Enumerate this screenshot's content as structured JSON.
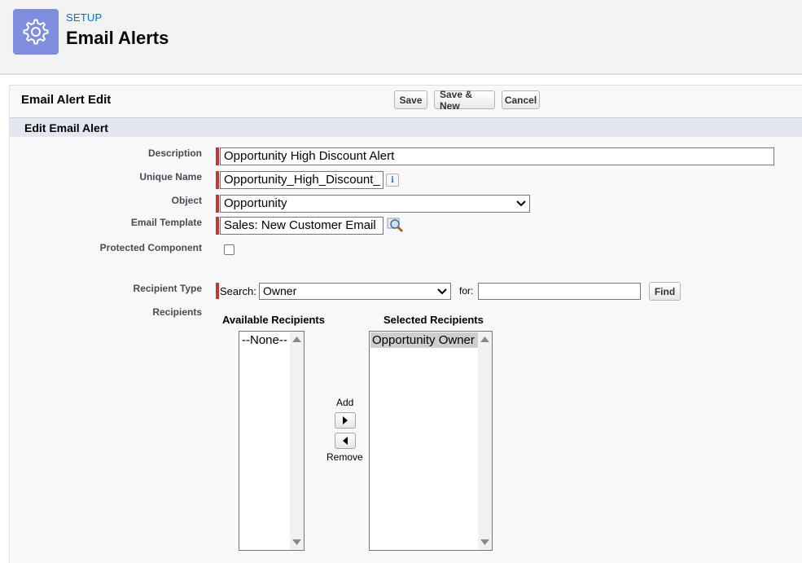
{
  "header": {
    "breadcrumb": "SETUP",
    "title": "Email Alerts",
    "icon": "gear-icon",
    "icon_bg": "#7f8de1"
  },
  "panel": {
    "title": "Email Alert Edit",
    "buttons": {
      "save": "Save",
      "save_new": "Save & New",
      "cancel": "Cancel"
    },
    "section_title": "Edit Email Alert"
  },
  "form": {
    "description": {
      "label": "Description",
      "value": "Opportunity High Discount Alert"
    },
    "unique_name": {
      "label": "Unique Name",
      "value": "Opportunity_High_Discount_",
      "info_icon": "info-icon"
    },
    "object": {
      "label": "Object",
      "value": "Opportunity"
    },
    "email_template": {
      "label": "Email Template",
      "value": "Sales: New Customer Email",
      "lookup_icon": "lookup-icon"
    },
    "protected_component": {
      "label": "Protected Component",
      "checked": false
    },
    "recipient_type": {
      "label": "Recipient Type",
      "search_label": "Search:",
      "search_value": "Owner",
      "for_label": "for:",
      "for_value": "",
      "find_button": "Find"
    },
    "recipients": {
      "label": "Recipients",
      "available_header": "Available Recipients",
      "available_items": [
        "--None--"
      ],
      "selected_header": "Selected Recipients",
      "selected_items": [
        "Opportunity Owner"
      ],
      "add_label": "Add",
      "remove_label": "Remove"
    }
  },
  "colors": {
    "required_marker": "#c23934",
    "section_bar": "#e4e7ef",
    "link": "#0070d2"
  }
}
